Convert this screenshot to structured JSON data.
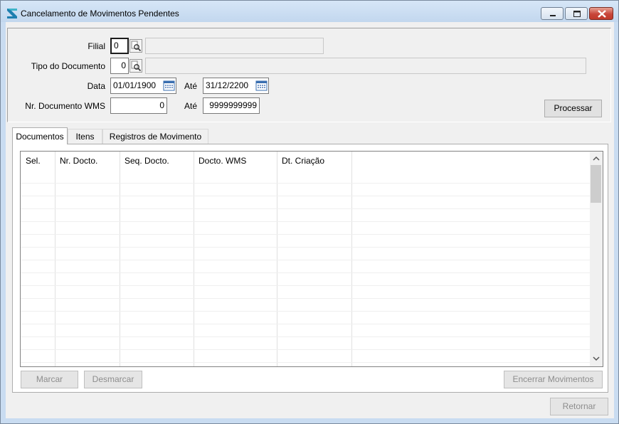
{
  "window": {
    "title": "Cancelamento de Movimentos Pendentes",
    "buttons": [
      "minimize-icon",
      "maximize-icon",
      "close-icon"
    ],
    "accent": "#c0392b"
  },
  "filters": {
    "filial": {
      "label": "Filial",
      "value": "0"
    },
    "tipo_documento": {
      "label": "Tipo do Documento",
      "value": "0"
    },
    "data": {
      "label": "Data",
      "from": "01/01/1900",
      "to_label": "Até",
      "to": "31/12/2200"
    },
    "nr_documento_wms": {
      "label": "Nr. Documento WMS",
      "from": "0",
      "to_label": "Até",
      "to": "9999999999"
    },
    "processar_label": "Processar"
  },
  "tabs": [
    {
      "label": "Documentos",
      "active": true
    },
    {
      "label": "Itens",
      "active": false
    },
    {
      "label": "Registros de Movimento",
      "active": false
    }
  ],
  "grid": {
    "columns": [
      "Sel.",
      "Nr. Docto.",
      "Seq. Docto.",
      "Docto. WMS",
      "Dt. Criação"
    ],
    "rows": []
  },
  "actions": {
    "marcar": "Marcar",
    "desmarcar": "Desmarcar",
    "encerrar": "Encerrar Movimentos",
    "retornar": "Retornar"
  }
}
